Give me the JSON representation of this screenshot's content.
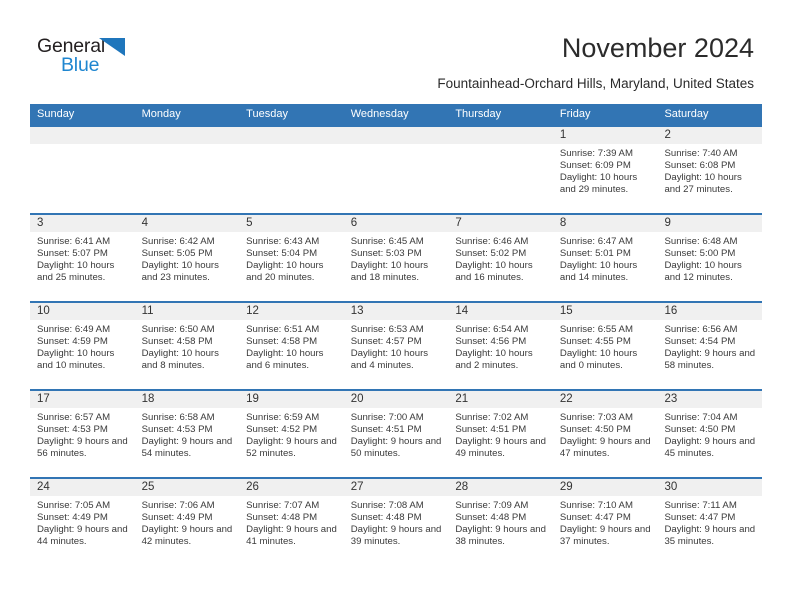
{
  "brand": {
    "name_top": "General",
    "name_bottom": "Blue",
    "triangle_color": "#1f76bc",
    "top_color": "#231f20",
    "bottom_color": "#1f86d0"
  },
  "header": {
    "month_title": "November 2024",
    "location": "Fountainhead-Orchard Hills, Maryland, United States"
  },
  "theme": {
    "header_blue": "#3275b4",
    "daynum_gray": "#f0f0f0",
    "text": "#3a3a3a"
  },
  "weekdays": [
    "Sunday",
    "Monday",
    "Tuesday",
    "Wednesday",
    "Thursday",
    "Friday",
    "Saturday"
  ],
  "weeks": [
    [
      {
        "day": "",
        "sunrise": "",
        "sunset": "",
        "daylight": ""
      },
      {
        "day": "",
        "sunrise": "",
        "sunset": "",
        "daylight": ""
      },
      {
        "day": "",
        "sunrise": "",
        "sunset": "",
        "daylight": ""
      },
      {
        "day": "",
        "sunrise": "",
        "sunset": "",
        "daylight": ""
      },
      {
        "day": "",
        "sunrise": "",
        "sunset": "",
        "daylight": ""
      },
      {
        "day": "1",
        "sunrise": "Sunrise: 7:39 AM",
        "sunset": "Sunset: 6:09 PM",
        "daylight": "Daylight: 10 hours and 29 minutes."
      },
      {
        "day": "2",
        "sunrise": "Sunrise: 7:40 AM",
        "sunset": "Sunset: 6:08 PM",
        "daylight": "Daylight: 10 hours and 27 minutes."
      }
    ],
    [
      {
        "day": "3",
        "sunrise": "Sunrise: 6:41 AM",
        "sunset": "Sunset: 5:07 PM",
        "daylight": "Daylight: 10 hours and 25 minutes."
      },
      {
        "day": "4",
        "sunrise": "Sunrise: 6:42 AM",
        "sunset": "Sunset: 5:05 PM",
        "daylight": "Daylight: 10 hours and 23 minutes."
      },
      {
        "day": "5",
        "sunrise": "Sunrise: 6:43 AM",
        "sunset": "Sunset: 5:04 PM",
        "daylight": "Daylight: 10 hours and 20 minutes."
      },
      {
        "day": "6",
        "sunrise": "Sunrise: 6:45 AM",
        "sunset": "Sunset: 5:03 PM",
        "daylight": "Daylight: 10 hours and 18 minutes."
      },
      {
        "day": "7",
        "sunrise": "Sunrise: 6:46 AM",
        "sunset": "Sunset: 5:02 PM",
        "daylight": "Daylight: 10 hours and 16 minutes."
      },
      {
        "day": "8",
        "sunrise": "Sunrise: 6:47 AM",
        "sunset": "Sunset: 5:01 PM",
        "daylight": "Daylight: 10 hours and 14 minutes."
      },
      {
        "day": "9",
        "sunrise": "Sunrise: 6:48 AM",
        "sunset": "Sunset: 5:00 PM",
        "daylight": "Daylight: 10 hours and 12 minutes."
      }
    ],
    [
      {
        "day": "10",
        "sunrise": "Sunrise: 6:49 AM",
        "sunset": "Sunset: 4:59 PM",
        "daylight": "Daylight: 10 hours and 10 minutes."
      },
      {
        "day": "11",
        "sunrise": "Sunrise: 6:50 AM",
        "sunset": "Sunset: 4:58 PM",
        "daylight": "Daylight: 10 hours and 8 minutes."
      },
      {
        "day": "12",
        "sunrise": "Sunrise: 6:51 AM",
        "sunset": "Sunset: 4:58 PM",
        "daylight": "Daylight: 10 hours and 6 minutes."
      },
      {
        "day": "13",
        "sunrise": "Sunrise: 6:53 AM",
        "sunset": "Sunset: 4:57 PM",
        "daylight": "Daylight: 10 hours and 4 minutes."
      },
      {
        "day": "14",
        "sunrise": "Sunrise: 6:54 AM",
        "sunset": "Sunset: 4:56 PM",
        "daylight": "Daylight: 10 hours and 2 minutes."
      },
      {
        "day": "15",
        "sunrise": "Sunrise: 6:55 AM",
        "sunset": "Sunset: 4:55 PM",
        "daylight": "Daylight: 10 hours and 0 minutes."
      },
      {
        "day": "16",
        "sunrise": "Sunrise: 6:56 AM",
        "sunset": "Sunset: 4:54 PM",
        "daylight": "Daylight: 9 hours and 58 minutes."
      }
    ],
    [
      {
        "day": "17",
        "sunrise": "Sunrise: 6:57 AM",
        "sunset": "Sunset: 4:53 PM",
        "daylight": "Daylight: 9 hours and 56 minutes."
      },
      {
        "day": "18",
        "sunrise": "Sunrise: 6:58 AM",
        "sunset": "Sunset: 4:53 PM",
        "daylight": "Daylight: 9 hours and 54 minutes."
      },
      {
        "day": "19",
        "sunrise": "Sunrise: 6:59 AM",
        "sunset": "Sunset: 4:52 PM",
        "daylight": "Daylight: 9 hours and 52 minutes."
      },
      {
        "day": "20",
        "sunrise": "Sunrise: 7:00 AM",
        "sunset": "Sunset: 4:51 PM",
        "daylight": "Daylight: 9 hours and 50 minutes."
      },
      {
        "day": "21",
        "sunrise": "Sunrise: 7:02 AM",
        "sunset": "Sunset: 4:51 PM",
        "daylight": "Daylight: 9 hours and 49 minutes."
      },
      {
        "day": "22",
        "sunrise": "Sunrise: 7:03 AM",
        "sunset": "Sunset: 4:50 PM",
        "daylight": "Daylight: 9 hours and 47 minutes."
      },
      {
        "day": "23",
        "sunrise": "Sunrise: 7:04 AM",
        "sunset": "Sunset: 4:50 PM",
        "daylight": "Daylight: 9 hours and 45 minutes."
      }
    ],
    [
      {
        "day": "24",
        "sunrise": "Sunrise: 7:05 AM",
        "sunset": "Sunset: 4:49 PM",
        "daylight": "Daylight: 9 hours and 44 minutes."
      },
      {
        "day": "25",
        "sunrise": "Sunrise: 7:06 AM",
        "sunset": "Sunset: 4:49 PM",
        "daylight": "Daylight: 9 hours and 42 minutes."
      },
      {
        "day": "26",
        "sunrise": "Sunrise: 7:07 AM",
        "sunset": "Sunset: 4:48 PM",
        "daylight": "Daylight: 9 hours and 41 minutes."
      },
      {
        "day": "27",
        "sunrise": "Sunrise: 7:08 AM",
        "sunset": "Sunset: 4:48 PM",
        "daylight": "Daylight: 9 hours and 39 minutes."
      },
      {
        "day": "28",
        "sunrise": "Sunrise: 7:09 AM",
        "sunset": "Sunset: 4:48 PM",
        "daylight": "Daylight: 9 hours and 38 minutes."
      },
      {
        "day": "29",
        "sunrise": "Sunrise: 7:10 AM",
        "sunset": "Sunset: 4:47 PM",
        "daylight": "Daylight: 9 hours and 37 minutes."
      },
      {
        "day": "30",
        "sunrise": "Sunrise: 7:11 AM",
        "sunset": "Sunset: 4:47 PM",
        "daylight": "Daylight: 9 hours and 35 minutes."
      }
    ]
  ]
}
